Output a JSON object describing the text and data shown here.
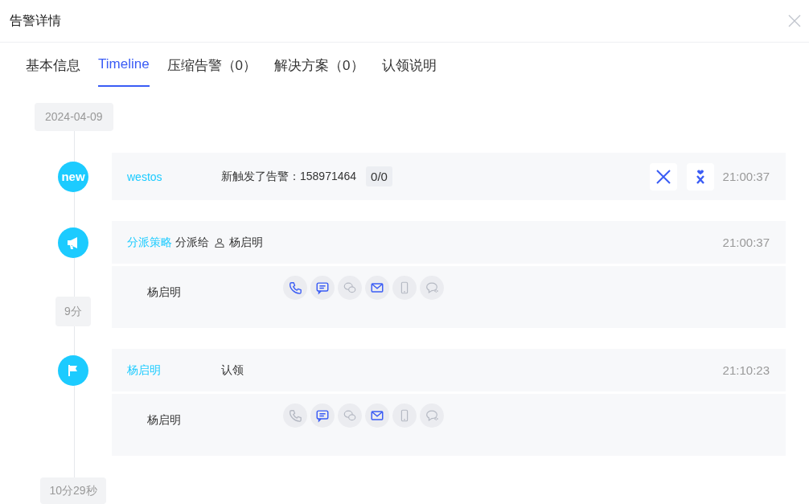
{
  "dialog": {
    "title": "告警详情"
  },
  "tabs": [
    {
      "label": "基本信息",
      "selected": false
    },
    {
      "label": "Timeline",
      "selected": true
    },
    {
      "label": "压缩告警（0）",
      "selected": false
    },
    {
      "label": "解决方案（0）",
      "selected": false
    },
    {
      "label": "认领说明",
      "selected": false
    }
  ],
  "timeline": {
    "items": [
      {
        "kind": "date",
        "text": "2024-04-09"
      },
      {
        "kind": "event",
        "marker": {
          "kind": "new",
          "text": "new"
        },
        "actor": "westos",
        "message": "新触发了告警：158971464",
        "count": "0/0",
        "actions": [
          {
            "kind": "close"
          },
          {
            "kind": "claim"
          }
        ],
        "time": "21:00:37"
      },
      {
        "kind": "event",
        "marker": {
          "kind": "dispatch"
        },
        "actor": "分派策略",
        "action": "分派给",
        "assignee": "杨启明",
        "time": "21:00:37",
        "duration": "9分",
        "notify": {
          "name": "杨启明",
          "channels": [
            {
              "kind": "phone",
              "on": true
            },
            {
              "kind": "sms",
              "on": true
            },
            {
              "kind": "wechat",
              "on": false
            },
            {
              "kind": "email",
              "on": true
            },
            {
              "kind": "mobile",
              "on": false
            },
            {
              "kind": "chat",
              "on": false
            }
          ]
        }
      },
      {
        "kind": "event",
        "marker": {
          "kind": "claim"
        },
        "actor": "杨启明",
        "message": "认领",
        "time": "21:10:23",
        "notify": {
          "name": "杨启明",
          "channels": [
            {
              "kind": "phone",
              "on": false
            },
            {
              "kind": "sms",
              "on": true
            },
            {
              "kind": "wechat",
              "on": false
            },
            {
              "kind": "email",
              "on": true
            },
            {
              "kind": "mobile",
              "on": false
            },
            {
              "kind": "chat",
              "on": false
            }
          ]
        }
      },
      {
        "kind": "duration",
        "text": "10分29秒"
      }
    ]
  }
}
